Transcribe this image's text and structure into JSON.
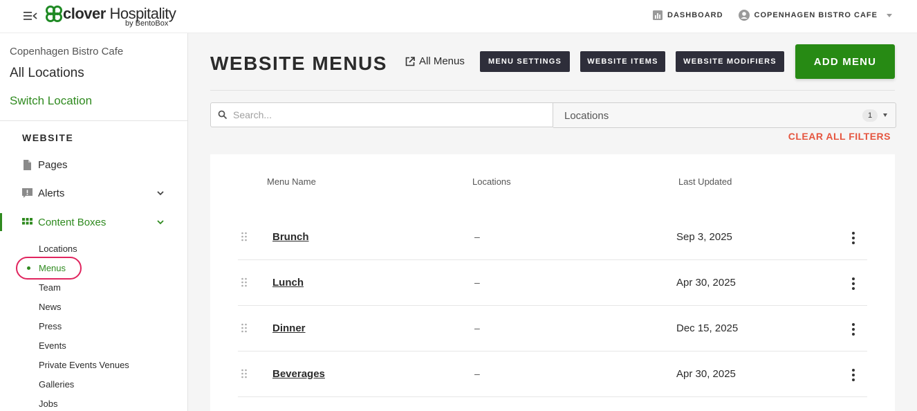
{
  "topbar": {
    "brand": "clover",
    "brand_sub": " Hospitality",
    "by": "by BentoBox",
    "dashboard_label": "DASHBOARD",
    "account_label": "COPENHAGEN BISTRO CAFE"
  },
  "sidebar": {
    "venue": "Copenhagen Bistro Cafe",
    "location_scope": "All Locations",
    "switch_location": "Switch Location",
    "section": "WEBSITE",
    "items": [
      {
        "label": "Pages",
        "icon": "page-icon"
      },
      {
        "label": "Alerts",
        "icon": "alert-icon"
      },
      {
        "label": "Content Boxes",
        "icon": "grid-icon"
      }
    ],
    "sub_items": [
      "Locations",
      "Menus",
      "Team",
      "News",
      "Press",
      "Events",
      "Private Events Venues",
      "Galleries",
      "Jobs"
    ],
    "active_sub": "Menus"
  },
  "main": {
    "title": "WEBSITE MENUS",
    "all_menus": "All Menus",
    "buttons": {
      "menu_settings": "MENU SETTINGS",
      "website_items": "WEBSITE ITEMS",
      "website_modifiers": "WEBSITE MODIFIERS",
      "add_menu": "ADD MENU"
    },
    "search": {
      "placeholder": "Search...",
      "value": ""
    },
    "locations_filter": {
      "label": "Locations",
      "count": "1"
    },
    "clear_filters": "CLEAR ALL FILTERS",
    "table": {
      "headers": [
        "Menu Name",
        "Locations",
        "Last Updated"
      ],
      "rows": [
        {
          "name": "Brunch",
          "locations": "–",
          "updated": "Sep 3, 2025"
        },
        {
          "name": "Lunch",
          "locations": "–",
          "updated": "Apr 30, 2025"
        },
        {
          "name": "Dinner",
          "locations": "–",
          "updated": "Dec 15, 2025"
        },
        {
          "name": "Beverages",
          "locations": "–",
          "updated": "Apr 30, 2025"
        }
      ]
    }
  },
  "colors": {
    "brand_green": "#278a14",
    "accent_green": "#2f8a1f",
    "dark_button": "#2e2e3a",
    "clear_filters": "#e5553f",
    "highlight": "#e0245e"
  }
}
